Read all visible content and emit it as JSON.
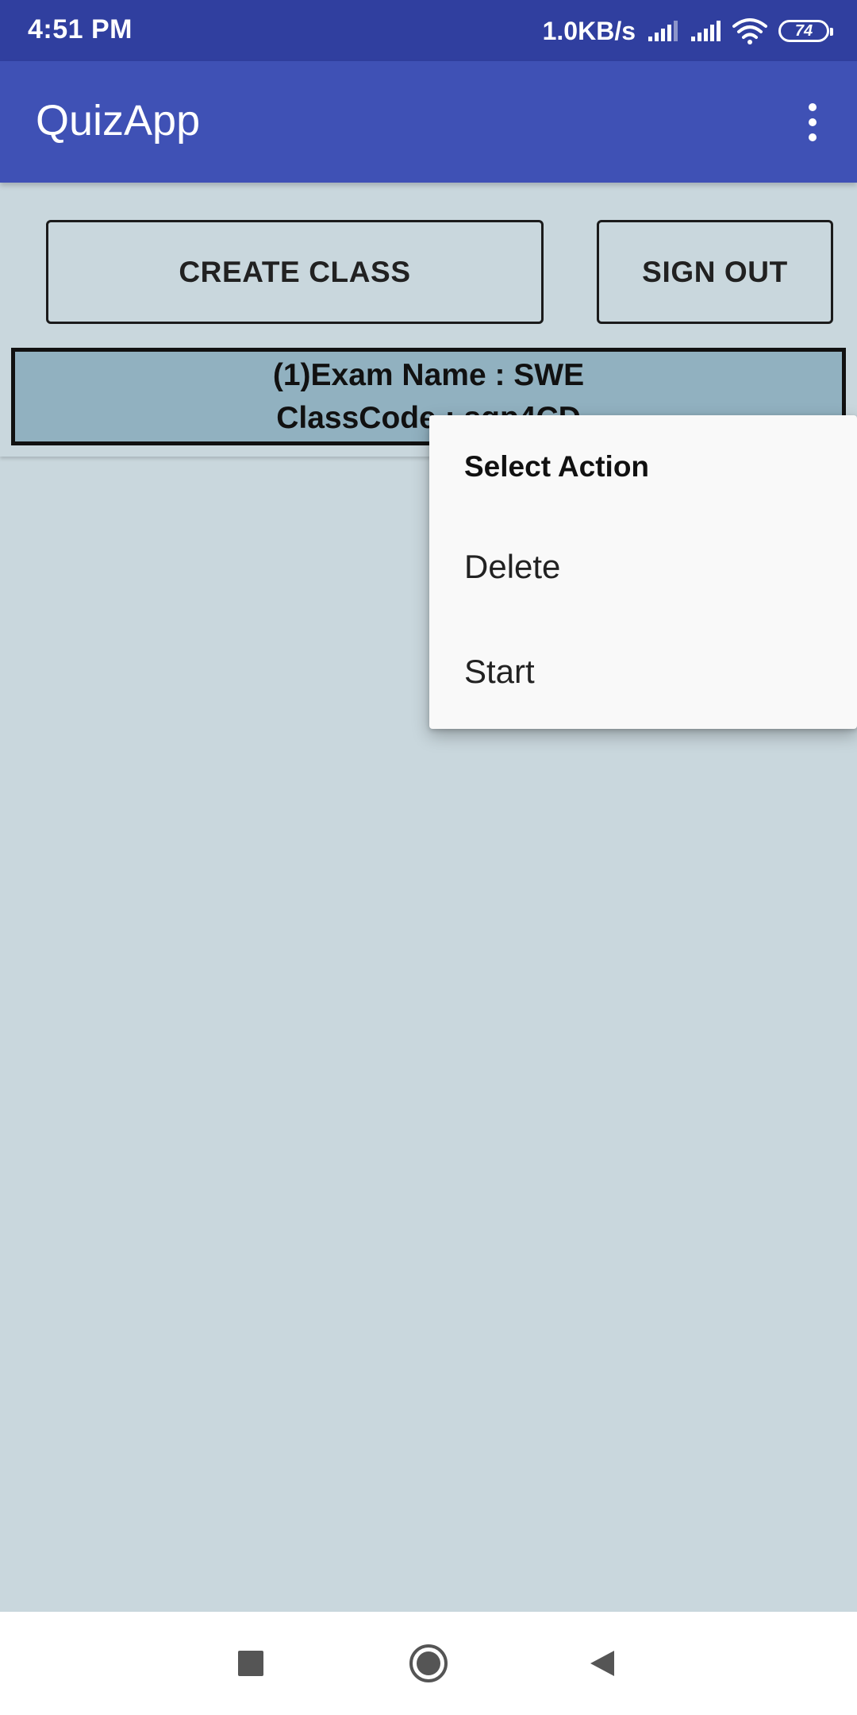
{
  "status_bar": {
    "time": "4:51 PM",
    "net_speed": "1.0KB/s",
    "battery_level": "74",
    "icons": [
      "signal-icon",
      "signal-icon",
      "wifi-icon",
      "battery-icon"
    ]
  },
  "app_bar": {
    "title": "QuizApp",
    "overflow_icon": "more-vert-icon"
  },
  "buttons": {
    "create_class": "CREATE CLASS",
    "sign_out": "SIGN OUT"
  },
  "exams": [
    {
      "line1": "(1)Exam Name : SWE",
      "line2": "ClassCode : sgp4CD"
    }
  ],
  "context_menu": {
    "title": "Select Action",
    "items": [
      {
        "label": "Delete"
      },
      {
        "label": "Start"
      }
    ]
  },
  "nav_bar": {
    "icons": [
      "recents-icon",
      "home-icon",
      "back-icon"
    ]
  },
  "colors": {
    "status_bar": "#303f9f",
    "app_bar": "#3f51b5",
    "background": "#c9d7dd",
    "exam_card": "#91b1c0",
    "menu": "#f9f9f9"
  }
}
